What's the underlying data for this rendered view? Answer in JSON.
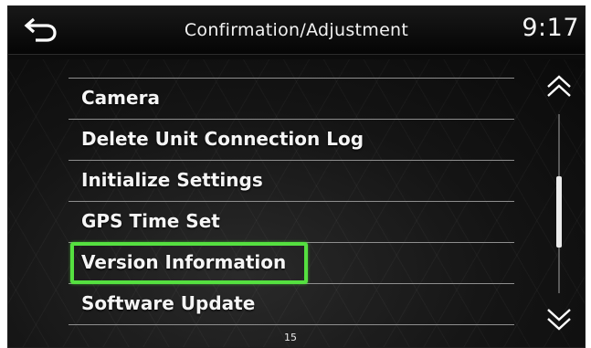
{
  "header": {
    "title": "Confirmation/Adjustment",
    "clock": "9:17"
  },
  "icons": {
    "back": "back-arrow-icon",
    "scroll_up": "double-chevron-up-icon",
    "scroll_down": "double-chevron-down-icon"
  },
  "menu": {
    "items": [
      {
        "label": "Camera"
      },
      {
        "label": "Delete Unit Connection Log"
      },
      {
        "label": "Initialize Settings"
      },
      {
        "label": "GPS Time Set"
      },
      {
        "label": "Version Information",
        "highlighted": true
      },
      {
        "label": "Software Update"
      }
    ]
  },
  "page_indicator": "15",
  "scroll_position": 0.6,
  "colors": {
    "highlight": "#55e040",
    "background": "#0c0c0c",
    "text": "#f5f5f5"
  }
}
